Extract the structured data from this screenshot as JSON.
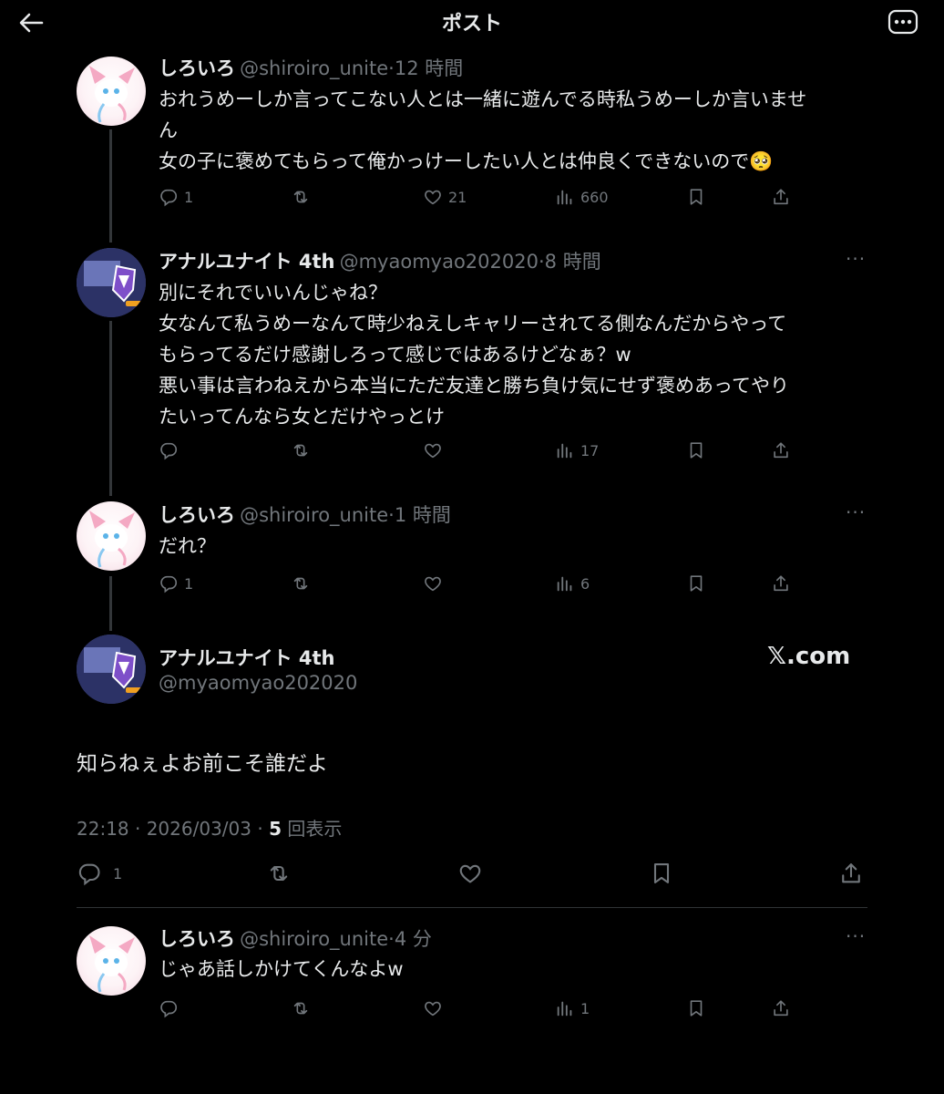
{
  "header": {
    "title": "ポスト"
  },
  "posts": [
    {
      "name": "しろいろ",
      "handle": "@shiroiro_unite",
      "time": "12 時間",
      "text": "おれうめーしか言ってこない人とは一緒に遊んでる時私うめーしか言いませ\nん\n女の子に褒めてもらって俺かっけーしたい人とは仲良くできないので🥺",
      "replies": "1",
      "likes": "21",
      "views": "660"
    },
    {
      "name": "アナルユナイト 4th",
      "handle": "@myaomyao202020",
      "time": "8 時間",
      "text": "別にそれでいいんじゃね？\n女なんて私うめーなんて時少ねえしキャリーされてる側なんだからやって\nもらってるだけ感謝しろって感じではあるけどなぁ？w\n悪い事は言わねえから本当にただ友達と勝ち負け気にせず褒めあってやり\nたいってんなら女とだけやっとけ",
      "replies": "",
      "likes": "",
      "views": "17"
    },
    {
      "name": "しろいろ",
      "handle": "@shiroiro_unite",
      "time": "1 時間",
      "text": "だれ？",
      "replies": "1",
      "likes": "",
      "views": "6"
    }
  ],
  "main_post": {
    "name": "アナルユナイト 4th",
    "handle": "@myaomyao202020",
    "badge": "𝕏.com",
    "text": "知らねぇよお前こそ誰だよ",
    "timestamp": "22:18 · 2026/03/03 · ",
    "view_count": "5",
    "view_label": " 回表示",
    "replies": "1"
  },
  "last_post": {
    "name": "しろいろ",
    "handle": "@shiroiro_unite",
    "time": "4 分",
    "text": "じゃあ話しかけてくんなよw",
    "views": "1"
  },
  "meta_separator": "·",
  "dots": "···",
  "colors": {
    "background": "#000000",
    "text": "#e7e9ea",
    "muted": "#71767b",
    "line": "#333639"
  }
}
